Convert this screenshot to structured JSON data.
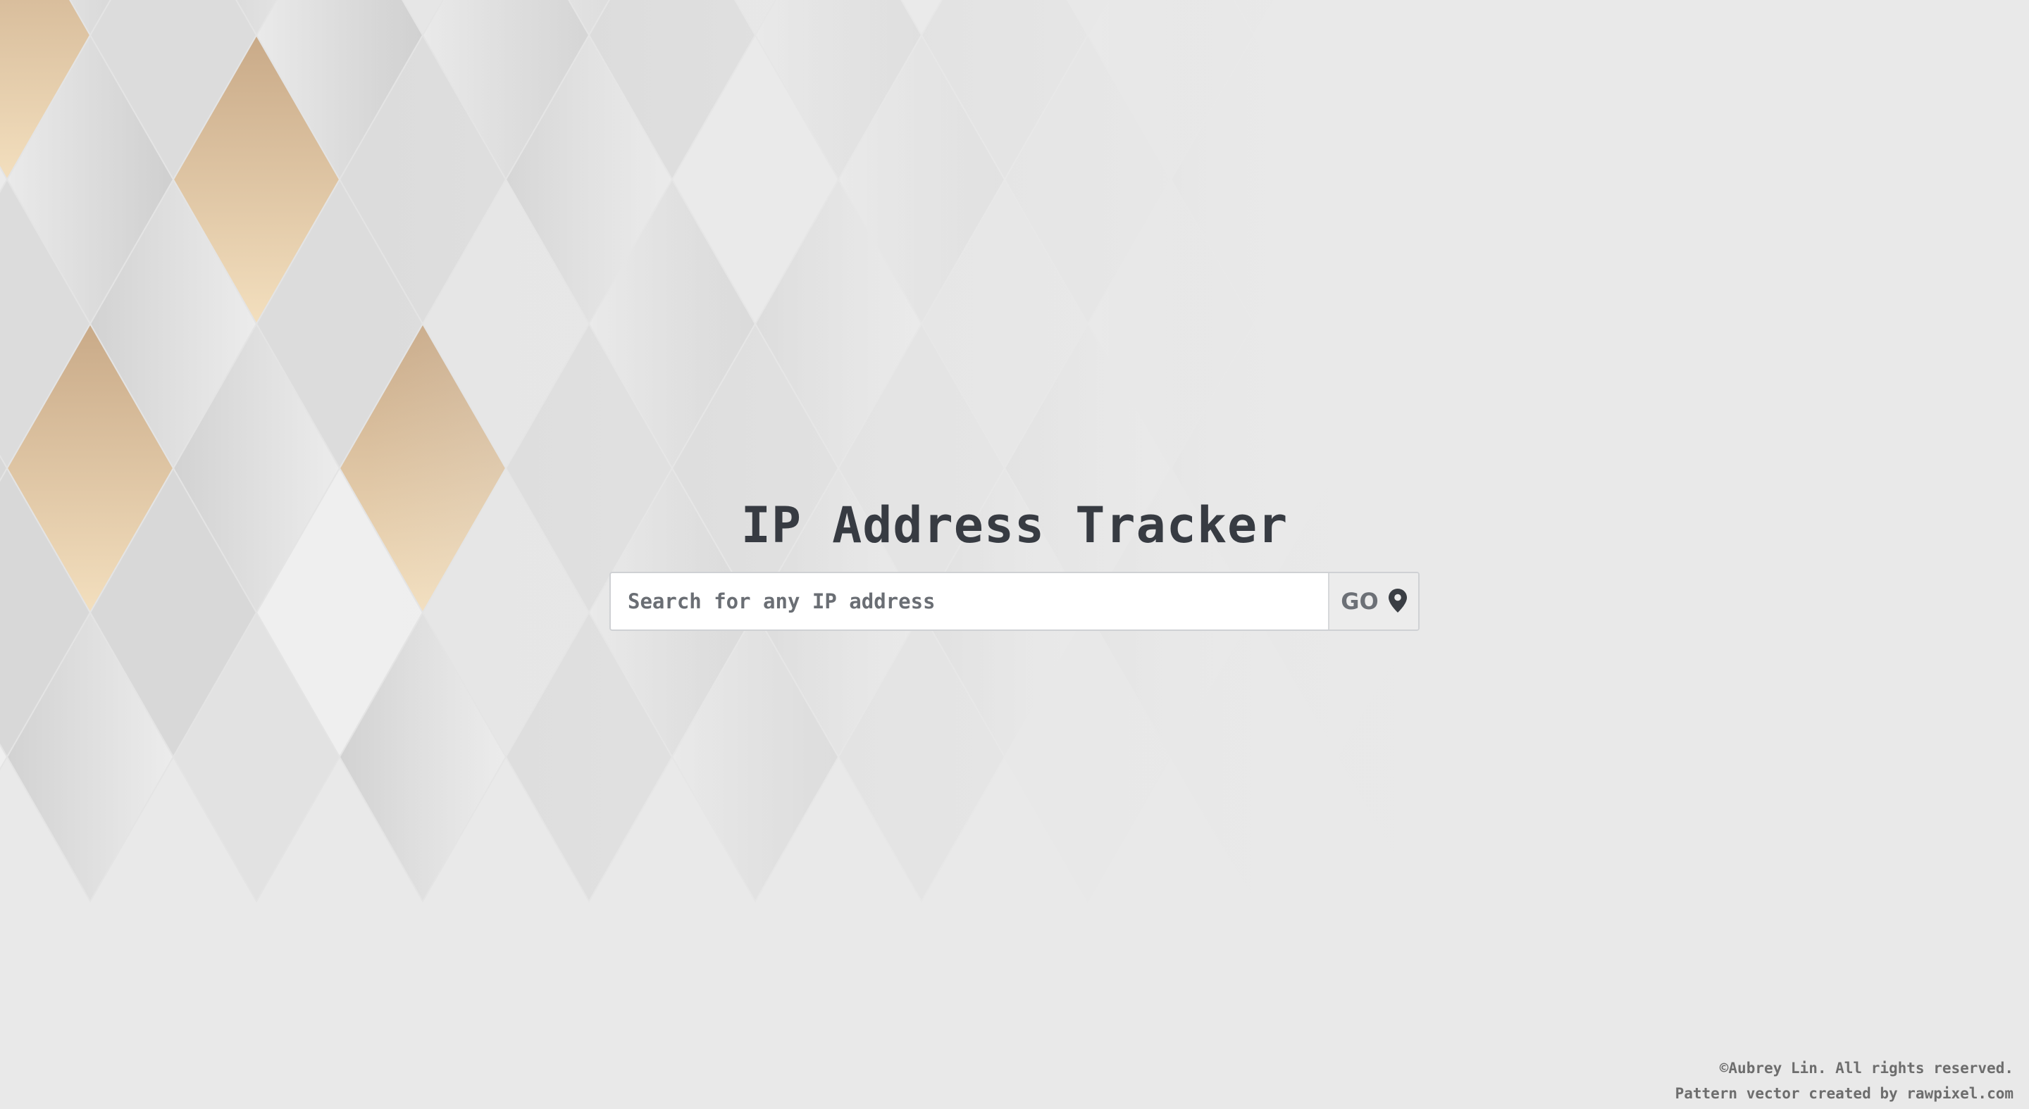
{
  "header": {
    "title": "IP Address Tracker"
  },
  "search": {
    "placeholder": "Search for any IP address",
    "value": "",
    "button_label": "GO",
    "button_icon": "map-pin-icon"
  },
  "footer": {
    "copyright": "©Aubrey Lin. All rights reserved.",
    "credit": "Pattern vector created by rawpixel.com"
  },
  "colors": {
    "background": "#e9e9e9",
    "title": "#373b42",
    "gold": "#d7b792",
    "gold_light": "#f2dfbd"
  }
}
